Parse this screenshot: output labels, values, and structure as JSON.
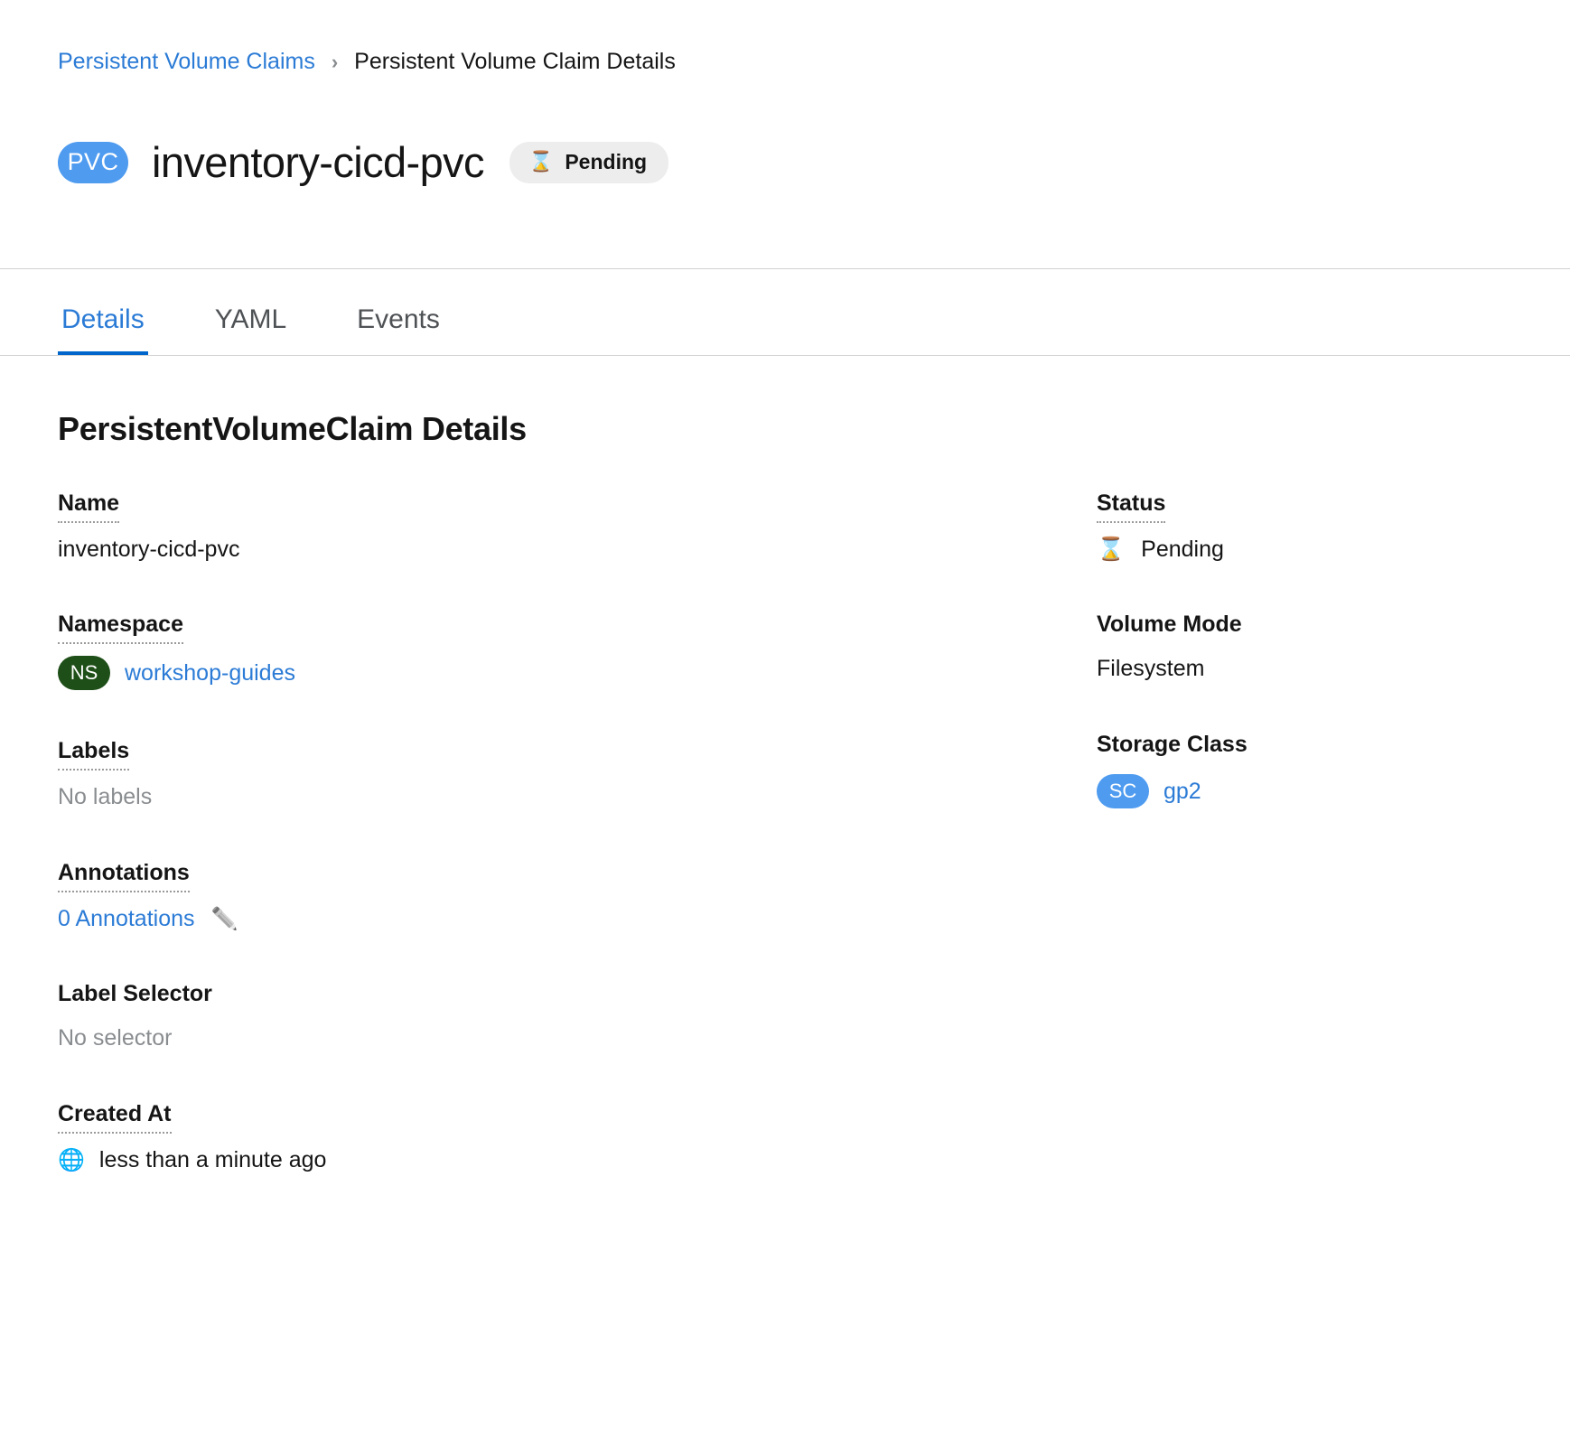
{
  "breadcrumb": {
    "parent": "Persistent Volume Claims",
    "separator": "›",
    "current": "Persistent Volume Claim Details"
  },
  "header": {
    "resource_badge": "PVC",
    "title": "inventory-cicd-pvc",
    "status_pill": {
      "icon": "hourglass-icon",
      "glyph": "⌛",
      "label": "Pending"
    }
  },
  "tabs": [
    {
      "label": "Details",
      "active": true
    },
    {
      "label": "YAML",
      "active": false
    },
    {
      "label": "Events",
      "active": false
    }
  ],
  "details": {
    "section_title": "PersistentVolumeClaim Details",
    "left": {
      "name": {
        "label": "Name",
        "value": "inventory-cicd-pvc"
      },
      "namespace": {
        "label": "Namespace",
        "badge": "NS",
        "value": "workshop-guides",
        "badge_color": "#1e4f18"
      },
      "labels": {
        "label": "Labels",
        "value": "No labels"
      },
      "annotations": {
        "label": "Annotations",
        "value": "0 Annotations",
        "edit_icon": "✏️"
      },
      "label_selector": {
        "label": "Label Selector",
        "value": "No selector"
      },
      "created_at": {
        "label": "Created At",
        "icon_glyph": "🌐",
        "value": "less than a minute ago"
      }
    },
    "right": {
      "status": {
        "label": "Status",
        "icon_glyph": "⌛",
        "value": "Pending"
      },
      "volume_mode": {
        "label": "Volume Mode",
        "value": "Filesystem"
      },
      "storage_class": {
        "label": "Storage Class",
        "badge": "SC",
        "value": "gp2",
        "badge_color": "#4e9bf0"
      }
    }
  },
  "colors": {
    "link": "#2b7bd6",
    "accent": "#0066cc",
    "badge_blue": "#4e9bf0",
    "badge_green": "#1e4f18",
    "muted": "#8a8d90"
  }
}
